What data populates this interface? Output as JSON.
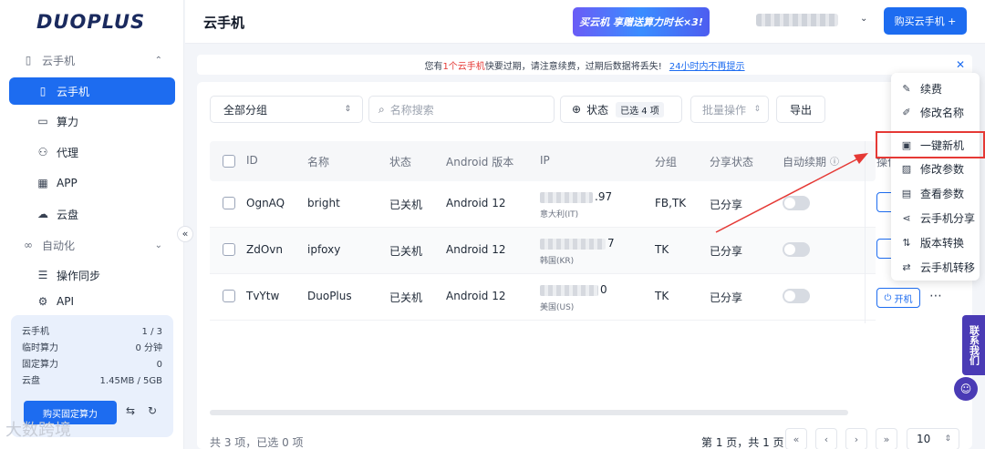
{
  "brand": {
    "logo": "DUOPLUS"
  },
  "sidebar": {
    "groups": [
      {
        "label": "云手机",
        "icon": "phone-outline-icon"
      },
      {
        "label": "自动化",
        "icon": "infinity-icon"
      }
    ],
    "items": [
      {
        "label": "云手机",
        "icon": "phone-icon",
        "active": true
      },
      {
        "label": "算力",
        "icon": "monitor-icon"
      },
      {
        "label": "代理",
        "icon": "network-icon"
      },
      {
        "label": "APP",
        "icon": "grid-icon"
      },
      {
        "label": "云盘",
        "icon": "cloud-icon"
      },
      {
        "label": "操作同步",
        "icon": "sync-icon"
      },
      {
        "label": "API",
        "icon": "api-icon"
      }
    ],
    "quota": {
      "rows": [
        {
          "label": "云手机",
          "value": "1 / 3"
        },
        {
          "label": "临时算力",
          "value": "0 分钟"
        },
        {
          "label": "固定算力",
          "value": "0"
        },
        {
          "label": "云盘",
          "value": "1.45MB / 5GB"
        }
      ],
      "buy_label": "购买固定算力"
    },
    "watermark": "大数跨境"
  },
  "header": {
    "title": "云手机",
    "promo": "买云机 享赠送算力时长×3!",
    "buy_label": "购买云手机 +"
  },
  "notice": {
    "prefix": "您有",
    "highlight": "1个云手机",
    "suffix": "快要过期，请注意续费，过期后数据将丢失!",
    "link": "24小时内不再提示"
  },
  "toolbar": {
    "group_select": "全部分组",
    "search_placeholder": "名称搜索",
    "status_label": "状态",
    "status_badge": "已选 4 项",
    "batch_label": "批量操作",
    "export_label": "导出"
  },
  "table": {
    "headers": [
      "ID",
      "名称",
      "状态",
      "Android 版本",
      "IP",
      "分组",
      "分享状态",
      "自动续期",
      "操作"
    ],
    "rows": [
      {
        "id": "OgnAQ",
        "name": "bright",
        "status": "已关机",
        "android": "Android 12",
        "ip_tail": ".97",
        "ip_loc": "意大利(IT)",
        "group": "FB,TK",
        "share": "已分享"
      },
      {
        "id": "ZdOvn",
        "name": "ipfoxy",
        "status": "已关机",
        "android": "Android 12",
        "ip_tail": "7",
        "ip_loc": "韩国(KR)",
        "group": "TK",
        "share": "已分享"
      },
      {
        "id": "TvYtw",
        "name": "DuoPlus",
        "status": "已关机",
        "android": "Android 12",
        "ip_tail": "0",
        "ip_loc": "美国(US)",
        "group": "TK",
        "share": "已分享"
      }
    ],
    "power_label": "开机"
  },
  "footer": {
    "summary": "共 3 项，已选 0 项",
    "page_info": "第 1 页，共 1 页",
    "page_size": "10"
  },
  "menu": {
    "items": [
      {
        "label": "续费",
        "icon": "renew-icon"
      },
      {
        "label": "修改名称",
        "icon": "edit-icon"
      },
      {
        "label": "一键新机",
        "icon": "new-device-icon"
      },
      {
        "label": "修改参数",
        "icon": "params-icon"
      },
      {
        "label": "查看参数",
        "icon": "doc-icon"
      },
      {
        "label": "云手机分享",
        "icon": "share-icon"
      },
      {
        "label": "版本转换",
        "icon": "convert-icon"
      },
      {
        "label": "云手机转移",
        "icon": "transfer-icon"
      }
    ]
  },
  "contact": {
    "label": "联系我们"
  },
  "colors": {
    "accent": "#1d6cf0",
    "highlight": "#e53935",
    "contact": "#4a3bb5"
  }
}
